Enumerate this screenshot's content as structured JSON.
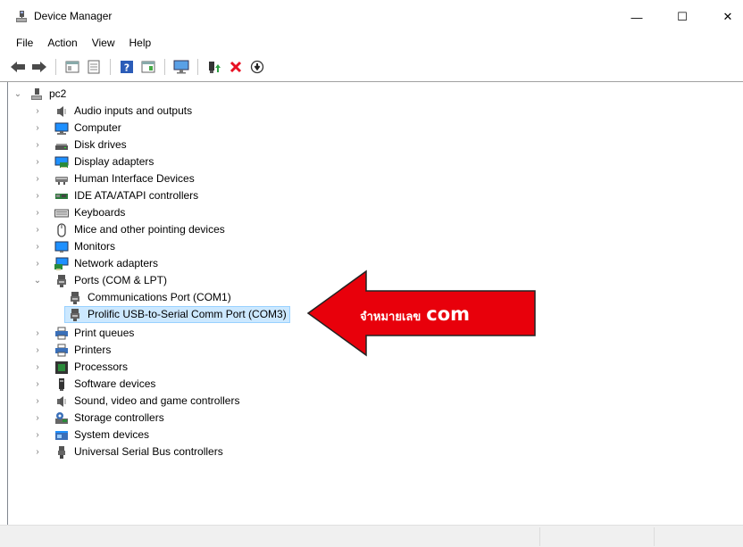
{
  "window": {
    "title": "Device Manager",
    "controls": {
      "minimize": "—",
      "maximize": "☐",
      "close": "✕"
    }
  },
  "menu": [
    "File",
    "Action",
    "View",
    "Help"
  ],
  "toolbar": {
    "icons": [
      "back-arrow-icon",
      "forward-arrow-icon",
      "show-hide-console-tree-icon",
      "properties-icon",
      "help-icon",
      "action-pane-icon",
      "monitor-icon",
      "update-driver-icon",
      "uninstall-device-icon",
      "download-icon"
    ]
  },
  "tree": {
    "root": "pc2",
    "categories": [
      {
        "label": "Audio inputs and outputs",
        "icon": "speaker-icon"
      },
      {
        "label": "Computer",
        "icon": "computer-icon"
      },
      {
        "label": "Disk drives",
        "icon": "disk-drive-icon"
      },
      {
        "label": "Display adapters",
        "icon": "display-adapter-icon"
      },
      {
        "label": "Human Interface Devices",
        "icon": "hid-icon"
      },
      {
        "label": "IDE ATA/ATAPI controllers",
        "icon": "ide-controller-icon"
      },
      {
        "label": "Keyboards",
        "icon": "keyboard-icon"
      },
      {
        "label": "Mice and other pointing devices",
        "icon": "mouse-icon"
      },
      {
        "label": "Monitors",
        "icon": "monitor-icon"
      },
      {
        "label": "Network adapters",
        "icon": "network-adapter-icon"
      },
      {
        "label": "Ports (COM & LPT)",
        "icon": "port-icon",
        "expanded": true,
        "children": [
          {
            "label": "Communications Port (COM1)",
            "icon": "port-icon"
          },
          {
            "label": "Prolific USB-to-Serial Comm Port (COM3)",
            "icon": "port-icon",
            "selected": true
          }
        ]
      },
      {
        "label": "Print queues",
        "icon": "printer-icon"
      },
      {
        "label": "Printers",
        "icon": "printer-icon"
      },
      {
        "label": "Processors",
        "icon": "processor-icon"
      },
      {
        "label": "Software devices",
        "icon": "software-device-icon"
      },
      {
        "label": "Sound, video and game controllers",
        "icon": "sound-icon"
      },
      {
        "label": "Storage controllers",
        "icon": "storage-controller-icon"
      },
      {
        "label": "System devices",
        "icon": "system-devices-icon"
      },
      {
        "label": "Universal Serial Bus controllers",
        "icon": "usb-icon"
      }
    ]
  },
  "annotation": {
    "text": "จำหมายเลข",
    "emphasis": "com",
    "color": "#e8000b"
  }
}
